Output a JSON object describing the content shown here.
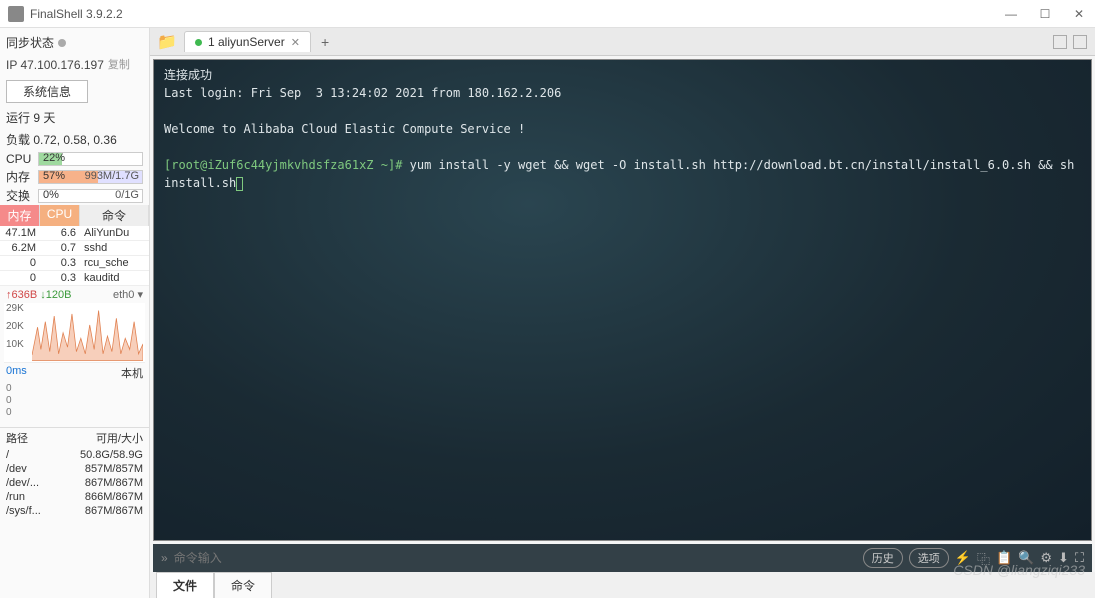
{
  "titlebar": {
    "title": "FinalShell 3.9.2.2"
  },
  "sidebar": {
    "sync_label": "同步状态",
    "ip": "IP 47.100.176.197",
    "copy": "复制",
    "sysinfo_btn": "系统信息",
    "uptime": "运行 9 天",
    "load": "负载 0.72, 0.58, 0.36",
    "cpu_label": "CPU",
    "cpu_pct": "22%",
    "mem_label": "内存",
    "mem_pct": "57%",
    "mem_text": "993M/1.7G",
    "swap_label": "交换",
    "swap_pct": "0%",
    "swap_text": "0/1G",
    "proc_headers": [
      "内存",
      "CPU",
      "命令"
    ],
    "procs": [
      {
        "mem": "47.1M",
        "cpu": "6.6",
        "cmd": "AliYunDu"
      },
      {
        "mem": "6.2M",
        "cpu": "0.7",
        "cmd": "sshd"
      },
      {
        "mem": "0",
        "cpu": "0.3",
        "cmd": "rcu_sche"
      },
      {
        "mem": "0",
        "cpu": "0.3",
        "cmd": "kauditd"
      }
    ],
    "net_up": "↑636B",
    "net_dn": "↓120B",
    "net_iface": "eth0 ▾",
    "chart_y": [
      "29K",
      "20K",
      "10K"
    ],
    "lat": "0ms",
    "lat_host": "本机",
    "lat_y": [
      "0",
      "0",
      "0"
    ],
    "disk_headers": [
      "路径",
      "可用/大小"
    ],
    "disks": [
      {
        "path": "/",
        "size": "50.8G/58.9G"
      },
      {
        "path": "/dev",
        "size": "857M/857M"
      },
      {
        "path": "/dev/...",
        "size": "867M/867M"
      },
      {
        "path": "/run",
        "size": "866M/867M"
      },
      {
        "path": "/sys/f...",
        "size": "867M/867M"
      }
    ]
  },
  "tabs": {
    "tab1": "1 aliyunServer",
    "add": "+"
  },
  "terminal": {
    "line1": "连接成功",
    "line2": "Last login: Fri Sep  3 13:24:02 2021 from 180.162.2.206",
    "line3": "",
    "line4": "Welcome to Alibaba Cloud Elastic Compute Service !",
    "line5": "",
    "prompt": "[root@iZuf6c44yjmkvhdsfza61xZ ~]# ",
    "cmd": "yum install -y wget && wget -O install.sh http://download.bt.cn/install/install_6.0.sh && sh install.sh"
  },
  "cmdbar": {
    "placeholder": "命令输入",
    "history": "历史",
    "options": "选项"
  },
  "bottom_tabs": {
    "files": "文件",
    "cmds": "命令"
  },
  "watermark": "CSDN @liangziqi233"
}
